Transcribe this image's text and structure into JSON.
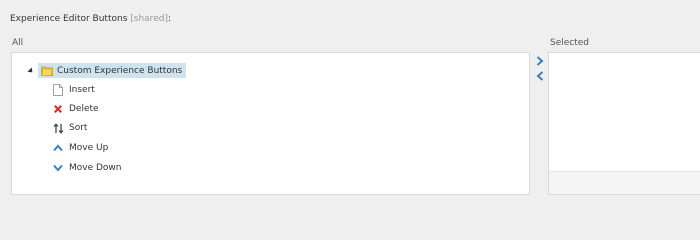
{
  "field": {
    "title": "Experience Editor Buttons",
    "shared_tag": "[shared]",
    "colon": ":"
  },
  "all_column": {
    "label": "All",
    "tree": {
      "root_label": "Custom Experience Buttons",
      "root_icon": "folder-icon",
      "items": [
        {
          "label": "Insert",
          "icon": "page-icon"
        },
        {
          "label": "Delete",
          "icon": "red-x-icon"
        },
        {
          "label": "Sort",
          "icon": "sort-arrows-icon"
        },
        {
          "label": "Move Up",
          "icon": "chevron-up-icon"
        },
        {
          "label": "Move Down",
          "icon": "chevron-down-icon"
        }
      ]
    }
  },
  "selected_column": {
    "label": "Selected"
  },
  "transfer_buttons": {
    "add_icon": "chevron-right-icon",
    "remove_icon": "chevron-left-icon"
  },
  "colors": {
    "selected_row": "#cfe3ee",
    "chevron_blue": "#3a7fc1",
    "delete_red": "#d62f2f",
    "folder_yellow": "#f2c233"
  }
}
